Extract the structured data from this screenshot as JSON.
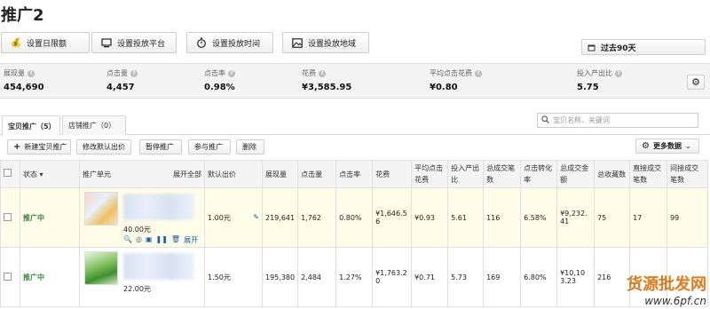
{
  "page": {
    "title": "推广2"
  },
  "toolbar": {
    "daily_limit": "设置日限额",
    "platform": "设置投放平台",
    "time": "设置投放时间",
    "region": "设置投放地域",
    "range": "过去90天"
  },
  "metrics": [
    {
      "label": "展现量",
      "value": "454,690"
    },
    {
      "label": "点击量",
      "value": "4,457"
    },
    {
      "label": "点击率",
      "value": "0.98%"
    },
    {
      "label": "花费",
      "value": "¥3,585.95"
    },
    {
      "label": "平均点击花费",
      "value": "¥0.80"
    },
    {
      "label": "投入产出比",
      "value": "5.75"
    }
  ],
  "tabs": [
    {
      "label": "宝贝推广（5）"
    },
    {
      "label": "店铺推广（0）"
    }
  ],
  "search": {
    "placeholder": "宝贝名称，关键词"
  },
  "actions": {
    "new": "新建宝贝推广",
    "edit_bid": "修改默认出价",
    "pause": "暂停推广",
    "join": "参与推广",
    "delete": "删除",
    "more_data": "更多数据"
  },
  "table": {
    "headers": {
      "status": "状态",
      "unit": "推广单元",
      "expand_all": "展开全部",
      "bid": "默认出价",
      "impressions": "展现量",
      "clicks": "点击量",
      "ctr": "点击率",
      "cost": "花费",
      "cpc": "平均点击花费",
      "roi": "投入产出比",
      "deals": "总成交笔数",
      "conv": "点击转化率",
      "amount": "总成交金额",
      "fav": "总收藏数",
      "direct": "直接成交笔数",
      "indirect": "间接成交笔数"
    },
    "rows": [
      {
        "status": "推广中",
        "price": "40.00元",
        "expand": "展开",
        "bid": "1.00元",
        "impressions": "219,641",
        "clicks": "1,762",
        "ctr": "0.80%",
        "cost": "¥1,646.56",
        "cpc": "¥0.93",
        "roi": "5.61",
        "deals": "116",
        "conv": "6.58%",
        "amount": "¥9,232.41",
        "fav": "75",
        "direct": "17",
        "indirect": "99"
      },
      {
        "status": "推广中",
        "price": "22.00元",
        "bid": "1.50元",
        "impressions": "195,380",
        "clicks": "2,484",
        "ctr": "1.27%",
        "cost": "¥1,763.20",
        "cpc": "¥0.71",
        "roi": "5.73",
        "deals": "169",
        "conv": "6.80%",
        "amount": "¥10,103.23",
        "fav": "216",
        "direct": "",
        "indirect": ""
      }
    ]
  },
  "watermark": {
    "cn": "货源批发网",
    "url": "www.6pf.cn"
  },
  "colors": {
    "status_green": "#2e8b2e",
    "highlight_row": "#fffde8",
    "link_blue": "#1a5ea8"
  }
}
